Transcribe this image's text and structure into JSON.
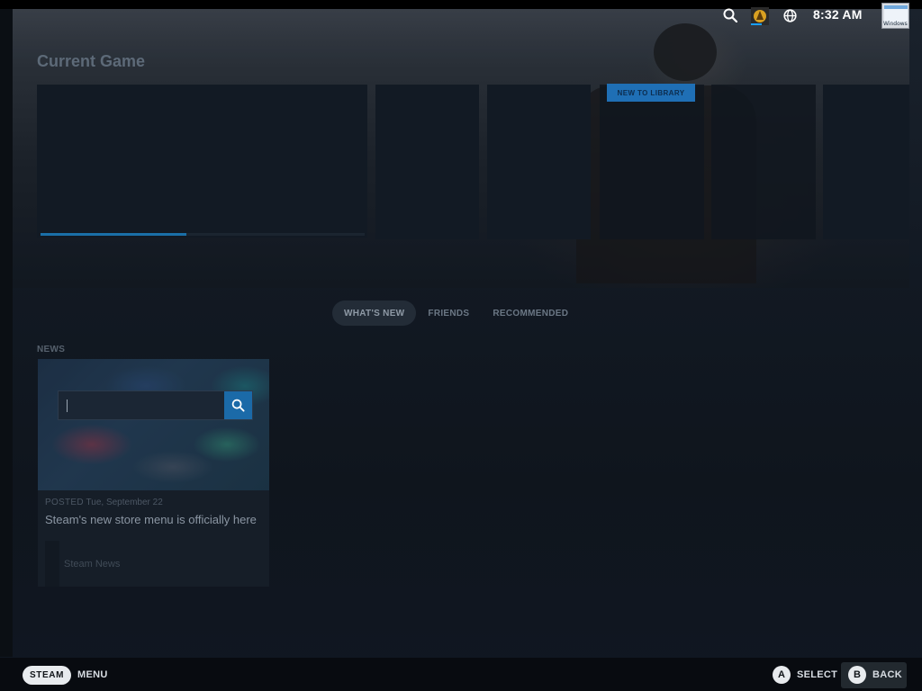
{
  "status": {
    "time": "8:32 AM",
    "avatar_label": "Windows"
  },
  "home": {
    "section_title": "Current Game",
    "badge": "NEW TO LIBRARY",
    "current_game_progress": 0.45
  },
  "tabs": [
    {
      "label": "WHAT'S NEW",
      "active": true
    },
    {
      "label": "FRIENDS",
      "active": false
    },
    {
      "label": "RECOMMENDED",
      "active": false
    }
  ],
  "news": {
    "section_label": "NEWS",
    "search_value": "",
    "posted_prefix": "POSTED",
    "posted_date": "Tue, September 22",
    "title": "Steam's new store menu is officially here",
    "source": "Steam News"
  },
  "footer": {
    "steam_label": "STEAM",
    "menu_label": "MENU",
    "a_glyph": "A",
    "select_label": "SELECT",
    "b_glyph": "B",
    "back_label": "BACK"
  },
  "colors": {
    "accent": "#1a9fff",
    "badge_bg": "#1f6fb5",
    "search_button": "#1b6aa8"
  }
}
